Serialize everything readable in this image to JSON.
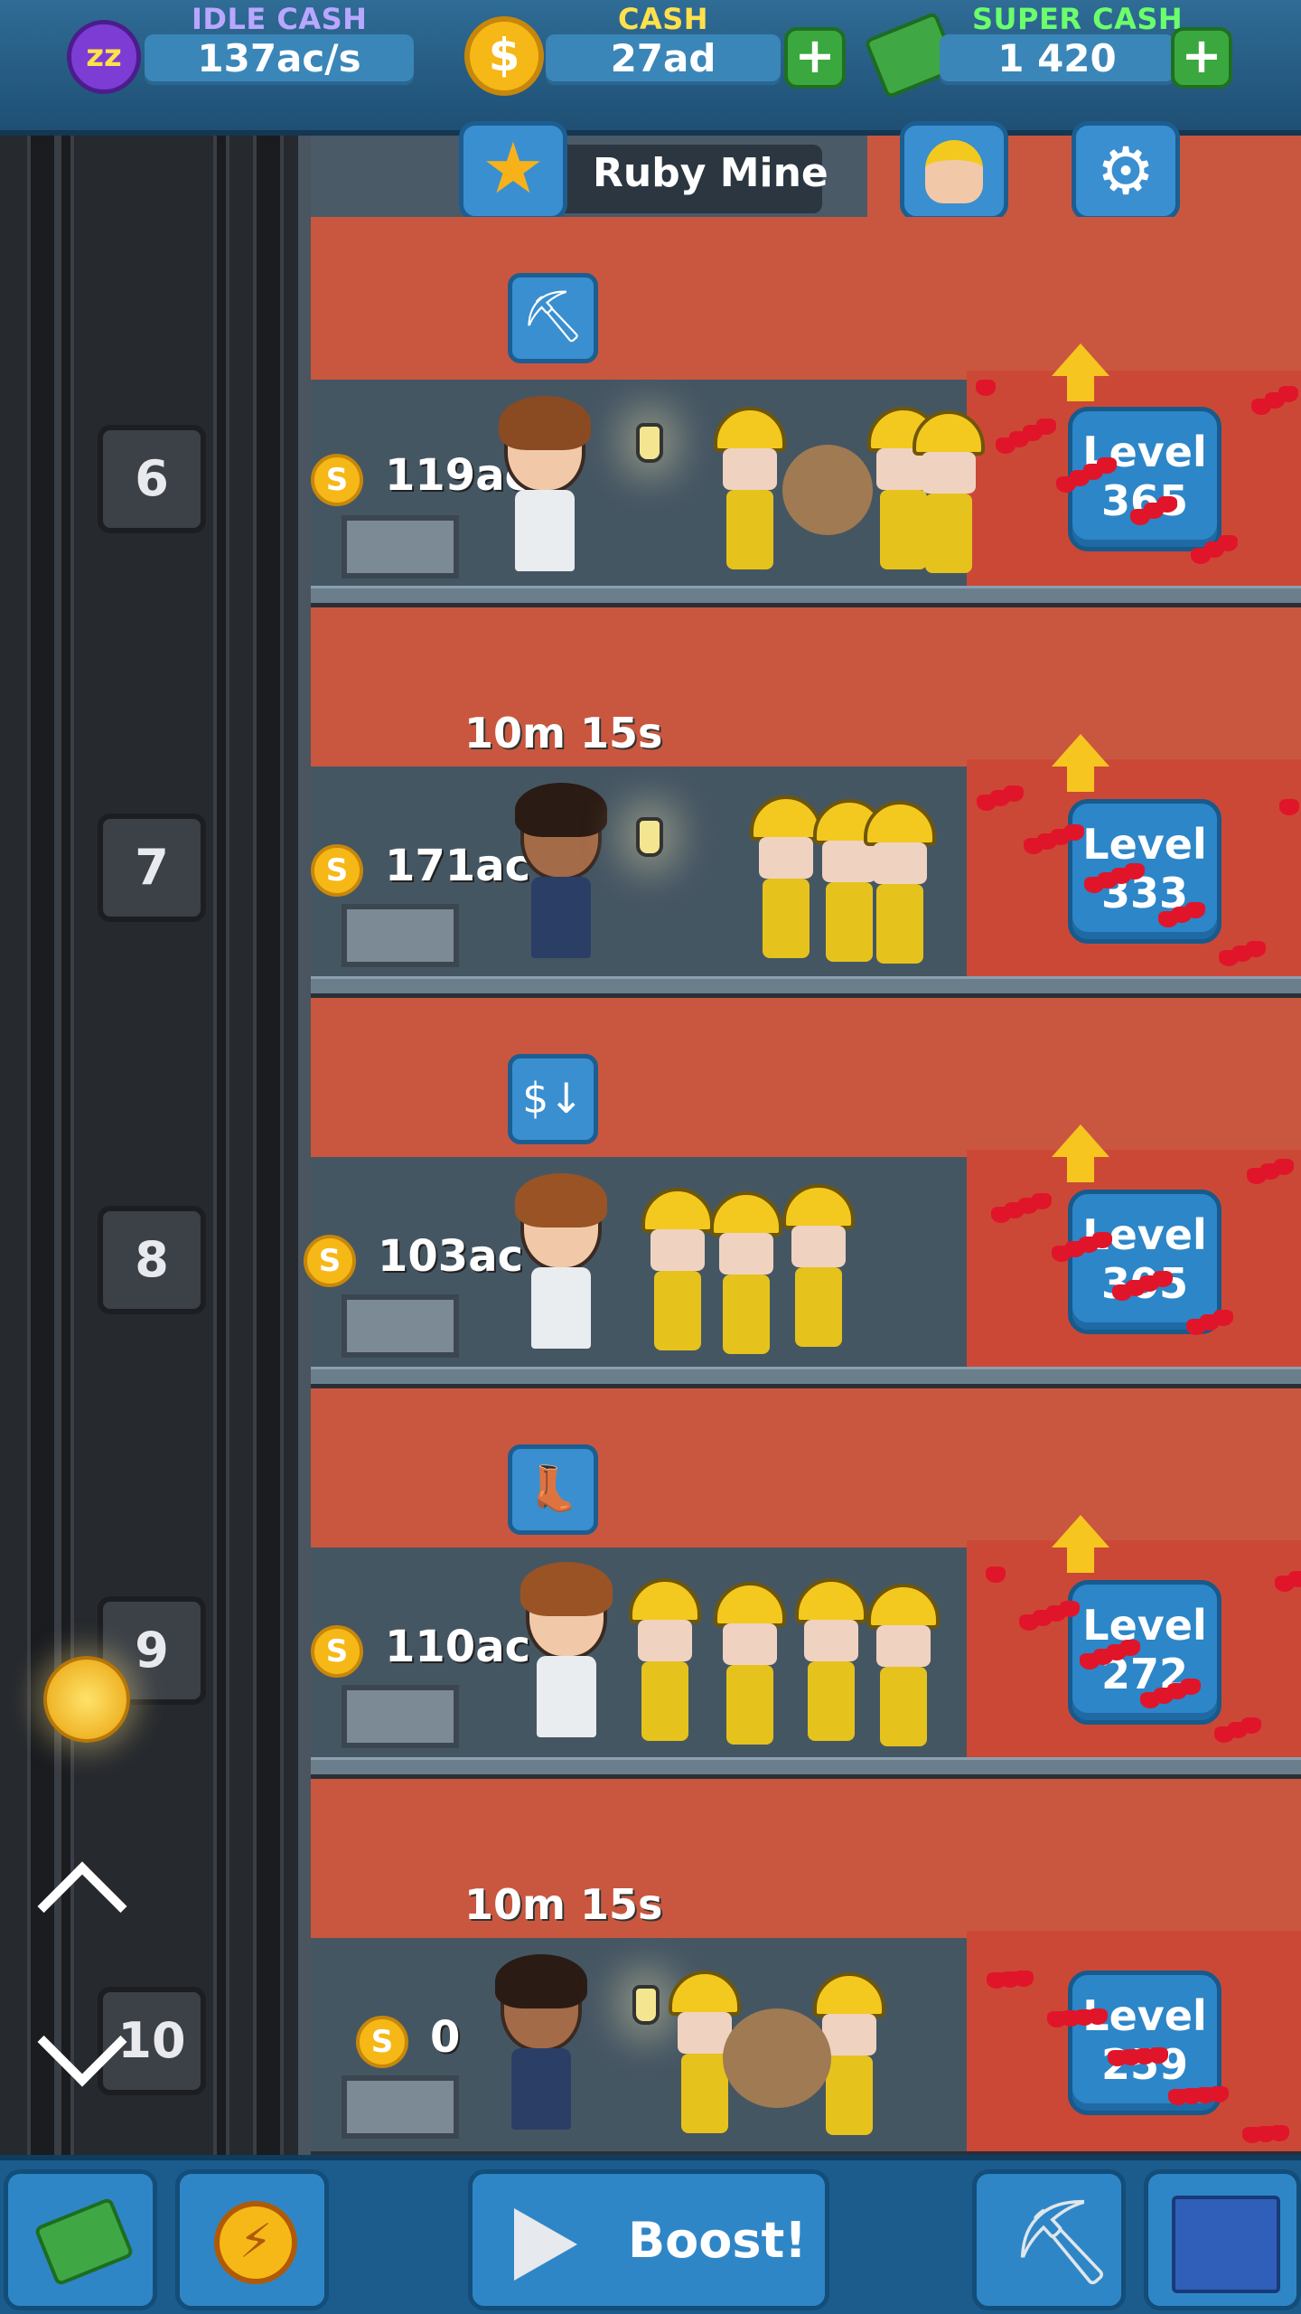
{
  "header": {
    "idle_cash": {
      "label": "IDLE CASH",
      "value": "137ac/s",
      "label_color": "#b9a7ff"
    },
    "cash": {
      "label": "CASH",
      "value": "27ad",
      "label_color": "#ffe14a"
    },
    "super_cash": {
      "label": "SUPER CASH",
      "value": "1 420",
      "label_color": "#6cff6c"
    },
    "plus_symbol": "+"
  },
  "mine_bar": {
    "title": "Ruby Mine"
  },
  "shafts": [
    {
      "number": "6",
      "earning": "119ac",
      "level_label": "Level",
      "level": "365",
      "timer": "",
      "skill_icon": "pickaxe-icon"
    },
    {
      "number": "7",
      "earning": "171ac",
      "level_label": "Level",
      "level": "333",
      "timer": "10m 15s",
      "skill_icon": ""
    },
    {
      "number": "8",
      "earning": "103ac",
      "level_label": "Level",
      "level": "305",
      "timer": "",
      "skill_icon": "cost-down-icon"
    },
    {
      "number": "9",
      "earning": "110ac",
      "level_label": "Level",
      "level": "272",
      "timer": "",
      "skill_icon": "boot-icon"
    },
    {
      "number": "10",
      "earning": "0",
      "level_label": "Level",
      "level": "259",
      "timer": "10m 15s",
      "skill_icon": ""
    }
  ],
  "coin_symbol": "S",
  "skill_glyphs": {
    "pickaxe": "⛏",
    "cost_down": "$↓",
    "boot": "👢"
  },
  "bottom": {
    "boost_label": "Boost!"
  },
  "colors": {
    "dirt": "#c9573f",
    "level_button": "#2c86c8",
    "ruby": "#e0152a",
    "miner_helmet": "#f3c91f"
  }
}
